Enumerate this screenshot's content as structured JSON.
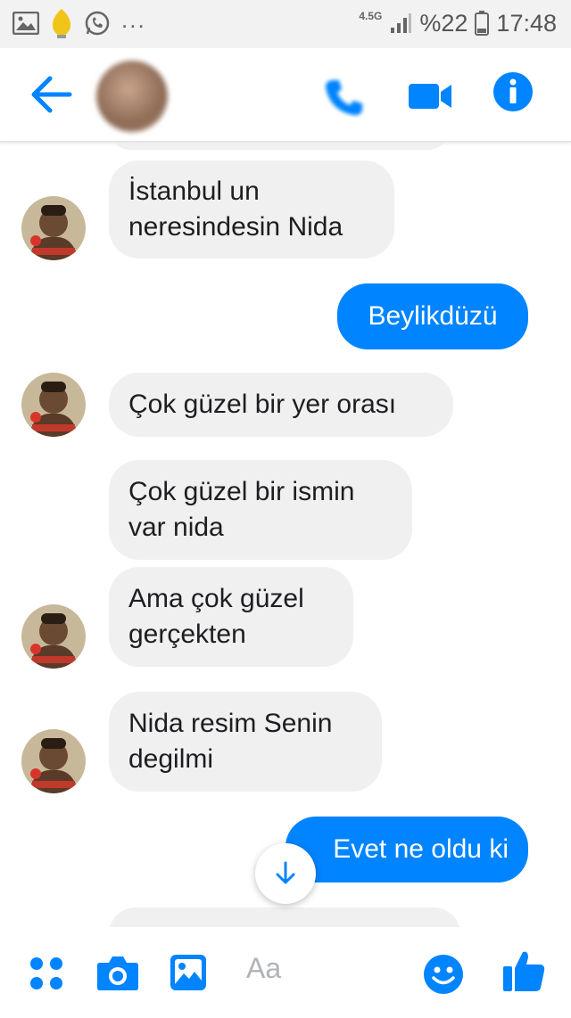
{
  "status_bar": {
    "network": "4.5G",
    "overflow": "...",
    "battery": "%22",
    "time": "17:48",
    "icons": [
      "gallery-icon",
      "lightbulb-icon",
      "whatsapp-icon",
      "signal-icon",
      "battery-icon"
    ]
  },
  "header": {
    "contact_name": "",
    "contact_status": "",
    "icons": [
      "back-arrow-icon",
      "phone-icon",
      "video-camera-icon",
      "info-icon"
    ],
    "accent": "#0084ff"
  },
  "messages": [
    {
      "direction": "in",
      "text": "İstanbul un\nneresindesin Nida",
      "avatar": true
    },
    {
      "direction": "out",
      "text": "Beylikdüzü"
    },
    {
      "direction": "in",
      "text": "Çok güzel bir yer orası",
      "avatar": true
    },
    {
      "direction": "in",
      "text": "Çok güzel bir ismin\nvar nida",
      "avatar": false
    },
    {
      "direction": "in",
      "text": "Ama çok güzel\ngerçekten",
      "avatar": true
    },
    {
      "direction": "in",
      "text": "Nida resim Senin\ndegilmi",
      "avatar": true
    },
    {
      "direction": "out",
      "text": "Evet ne oldu ki"
    }
  ],
  "composer": {
    "placeholder": "Aa",
    "icons": [
      "apps-grid-icon",
      "camera-icon",
      "image-icon",
      "emoji-icon",
      "thumbs-up-icon"
    ]
  },
  "colors": {
    "outgoing_bubble": "#0084ff",
    "incoming_bubble": "#f1f0f0",
    "icon_blue": "#0084ff"
  }
}
